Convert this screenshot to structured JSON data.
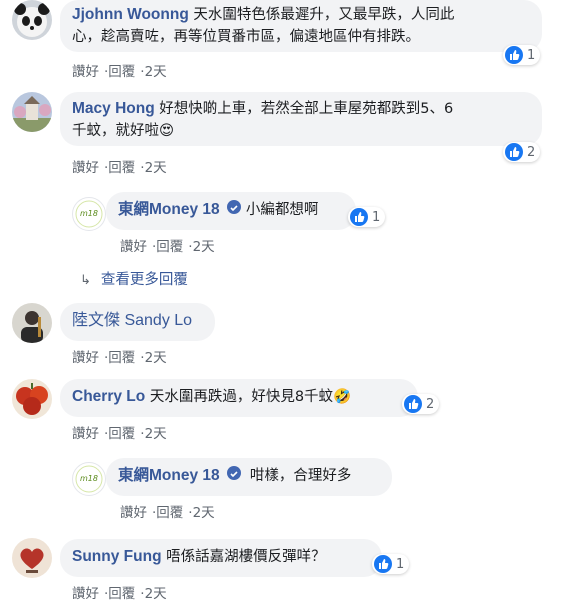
{
  "comments": [
    {
      "author": "Jjohnn Woonng",
      "text": "天水圍特色係最遲升，又最早跌，人同此心，趁高賣咗，再等位買番市區，偏遠地區仲有排跌。",
      "line1": "天水圍特色係最遲升，又最早跌，人同此",
      "line2": "心，趁高賣咗，再等位買番市區，偏遠地區仲有排跌。",
      "like": "讚好",
      "reply": "回覆",
      "time": "2天",
      "reactions": "1"
    },
    {
      "author": "Macy Hong",
      "text": "好想快啲上車，若然全部上車屋苑都跌到5、6千蚊，就好啦😍",
      "line1": "好想快啲上車，若然全部上車屋苑都跌到5、6",
      "line2": "千蚊，就好啦😍",
      "like": "讚好",
      "reply": "回覆",
      "time": "2天",
      "reactions": "2",
      "replies": [
        {
          "author": "東網Money 18",
          "text": "小編都想啊",
          "like": "讚好",
          "reply": "回覆",
          "time": "2天",
          "reactions": "1"
        }
      ],
      "more_replies": "查看更多回覆"
    },
    {
      "author": "陸文傑 Sandy Lo",
      "text": "",
      "like": "讚好",
      "reply": "回覆",
      "time": "2天"
    },
    {
      "author": "Cherry Lo",
      "text": "天水圍再跌過，好快見8千蚊🤣",
      "like": "讚好",
      "reply": "回覆",
      "time": "2天",
      "reactions": "2",
      "replies": [
        {
          "author": "東網Money 18",
          "text": "咁樣，合理好多",
          "like": "讚好",
          "reply": "回覆",
          "time": "2天"
        }
      ]
    },
    {
      "author": "Sunny Fung",
      "text": "唔係話嘉湖樓價反彈咩？",
      "like": "讚好",
      "reply": "回覆",
      "time": "2天",
      "reactions": "1"
    }
  ],
  "colors": {
    "link": "#385898",
    "bubble": "#f2f3f5",
    "like_blue": "#1877f2",
    "meta": "#606770"
  },
  "icons": {
    "like": "thumbs-up-icon",
    "reply_arrow": "reply-arrow-icon",
    "verified": "verified-badge-icon"
  }
}
